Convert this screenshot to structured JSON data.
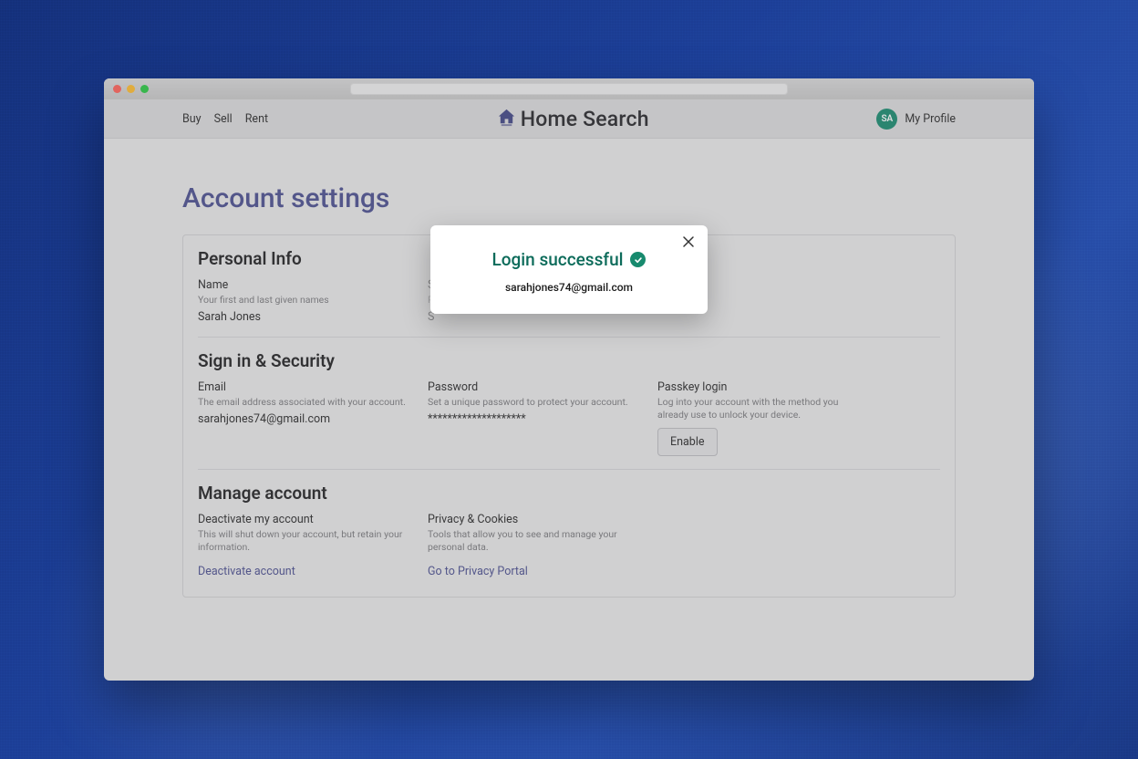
{
  "nav": {
    "links": [
      "Buy",
      "Sell",
      "Rent"
    ],
    "brand": "Home Search",
    "avatar_initials": "SA",
    "profile_label": "My Profile"
  },
  "page": {
    "title": "Account settings"
  },
  "personal_info": {
    "section_title": "Personal Info",
    "name": {
      "label": "Name",
      "desc": "Your first and last given names",
      "value": "Sarah Jones"
    },
    "col2": {
      "label": "S",
      "desc": "P",
      "value": "S"
    }
  },
  "security": {
    "section_title": "Sign in & Security",
    "email": {
      "label": "Email",
      "desc": "The email address associated with your account.",
      "value": "sarahjones74@gmail.com"
    },
    "password": {
      "label": "Password",
      "desc": "Set a unique password to protect your account.",
      "value": "********************"
    },
    "passkey": {
      "label": "Passkey login",
      "desc": "Log into your account with the method you already use to unlock your device.",
      "button": "Enable"
    }
  },
  "manage": {
    "section_title": "Manage account",
    "deactivate": {
      "label": "Deactivate my account",
      "desc": "This will shut down your account, but retain your information.",
      "link": "Deactivate account"
    },
    "privacy": {
      "label": "Privacy & Cookies",
      "desc": "Tools that allow you to see and manage your personal data.",
      "link": "Go to Privacy Portal"
    }
  },
  "modal": {
    "title": "Login successful",
    "email": "sarahjones74@gmail.com"
  }
}
